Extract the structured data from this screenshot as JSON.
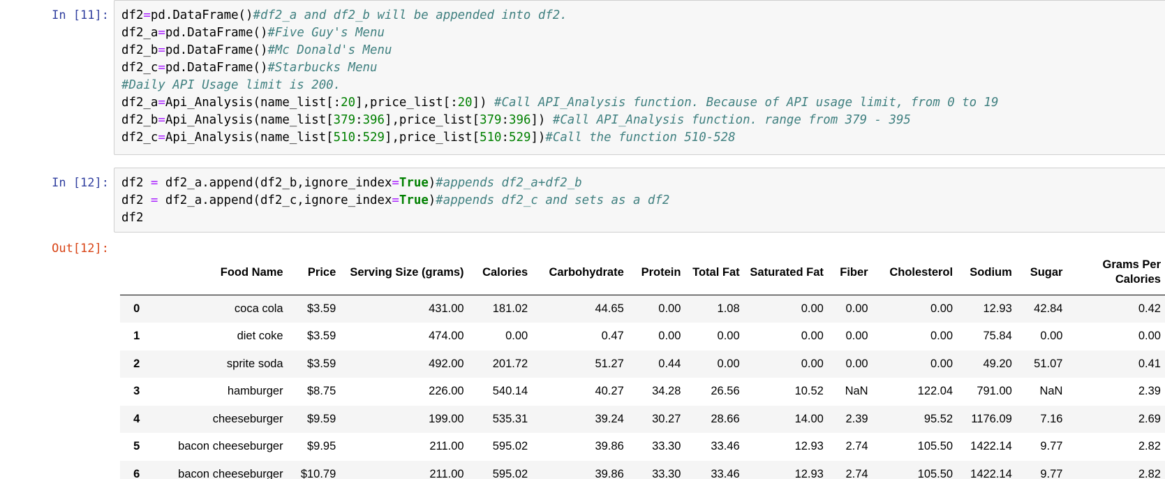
{
  "cells": [
    {
      "prompt": "In [11]:",
      "lines": [
        [
          [
            "df2",
            ""
          ],
          [
            "=",
            "o"
          ],
          [
            "pd.DataFrame()",
            ""
          ],
          [
            "#df2_a and df2_b will be appended into df2.",
            "c"
          ]
        ],
        [
          [
            "df2_a",
            ""
          ],
          [
            "=",
            "o"
          ],
          [
            "pd.DataFrame()",
            ""
          ],
          [
            "#Five Guy's Menu",
            "c"
          ]
        ],
        [
          [
            "df2_b",
            ""
          ],
          [
            "=",
            "o"
          ],
          [
            "pd.DataFrame()",
            ""
          ],
          [
            "#Mc Donald's Menu",
            "c"
          ]
        ],
        [
          [
            "df2_c",
            ""
          ],
          [
            "=",
            "o"
          ],
          [
            "pd.DataFrame()",
            ""
          ],
          [
            "#Starbucks Menu",
            "c"
          ]
        ],
        [
          [
            "#Daily API Usage limit is 200.",
            "c"
          ]
        ],
        [
          [
            "df2_a",
            ""
          ],
          [
            "=",
            "o"
          ],
          [
            "Api_Analysis(name_list[:",
            ""
          ],
          [
            "20",
            "n"
          ],
          [
            "],price_list[:",
            ""
          ],
          [
            "20",
            "n"
          ],
          [
            "]) ",
            ""
          ],
          [
            "#Call API_Analysis function. Because of API usage limit, from 0 to 19",
            "c"
          ]
        ],
        [
          [
            "df2_b",
            ""
          ],
          [
            "=",
            "o"
          ],
          [
            "Api_Analysis(name_list[",
            ""
          ],
          [
            "379",
            "n"
          ],
          [
            ":",
            ""
          ],
          [
            "396",
            "n"
          ],
          [
            "],price_list[",
            ""
          ],
          [
            "379",
            "n"
          ],
          [
            ":",
            ""
          ],
          [
            "396",
            "n"
          ],
          [
            "]) ",
            ""
          ],
          [
            "#Call API_Analysis function. range from 379 - 395",
            "c"
          ]
        ],
        [
          [
            "df2_c",
            ""
          ],
          [
            "=",
            "o"
          ],
          [
            "Api_Analysis(name_list[",
            ""
          ],
          [
            "510",
            "n"
          ],
          [
            ":",
            ""
          ],
          [
            "529",
            "n"
          ],
          [
            "],price_list[",
            ""
          ],
          [
            "510",
            "n"
          ],
          [
            ":",
            ""
          ],
          [
            "529",
            "n"
          ],
          [
            "])",
            ""
          ],
          [
            "#Call the function 510-528",
            "c"
          ]
        ]
      ]
    },
    {
      "prompt": "In [12]:",
      "lines": [
        [
          [
            "df2 ",
            ""
          ],
          [
            "=",
            "o"
          ],
          [
            " df2_a.append(df2_b,ignore_index",
            ""
          ],
          [
            "=",
            "o"
          ],
          [
            "True",
            "k"
          ],
          [
            ")",
            ""
          ],
          [
            "#appends df2_a+df2_b",
            "c"
          ]
        ],
        [
          [
            "df2 ",
            ""
          ],
          [
            "=",
            "o"
          ],
          [
            " df2_a.append(df2_c,ignore_index",
            ""
          ],
          [
            "=",
            "o"
          ],
          [
            "True",
            "k"
          ],
          [
            ")",
            ""
          ],
          [
            "#appends df2_c and sets as a df2",
            "c"
          ]
        ],
        [
          [
            "df2",
            ""
          ]
        ]
      ]
    }
  ],
  "output": {
    "prompt": "Out[12]:",
    "columns": [
      "",
      "Food Name",
      "Price",
      "Serving Size (grams)",
      "Calories",
      "Carbohydrate",
      "Protein",
      "Total Fat",
      "Saturated Fat",
      "Fiber",
      "Cholesterol",
      "Sodium",
      "Sugar",
      "Grams Per Calories"
    ],
    "rows": [
      [
        "0",
        "coca cola",
        "$3.59",
        "431.00",
        "181.02",
        "44.65",
        "0.00",
        "1.08",
        "0.00",
        "0.00",
        "0.00",
        "12.93",
        "42.84",
        "0.42"
      ],
      [
        "1",
        "diet coke",
        "$3.59",
        "474.00",
        "0.00",
        "0.47",
        "0.00",
        "0.00",
        "0.00",
        "0.00",
        "0.00",
        "75.84",
        "0.00",
        "0.00"
      ],
      [
        "2",
        "sprite soda",
        "$3.59",
        "492.00",
        "201.72",
        "51.27",
        "0.44",
        "0.00",
        "0.00",
        "0.00",
        "0.00",
        "49.20",
        "51.07",
        "0.41"
      ],
      [
        "3",
        "hamburger",
        "$8.75",
        "226.00",
        "540.14",
        "40.27",
        "34.28",
        "26.56",
        "10.52",
        "NaN",
        "122.04",
        "791.00",
        "NaN",
        "2.39"
      ],
      [
        "4",
        "cheeseburger",
        "$9.59",
        "199.00",
        "535.31",
        "39.24",
        "30.27",
        "28.66",
        "14.00",
        "2.39",
        "95.52",
        "1176.09",
        "7.16",
        "2.69"
      ],
      [
        "5",
        "bacon cheeseburger",
        "$9.95",
        "211.00",
        "595.02",
        "39.86",
        "33.30",
        "33.46",
        "12.93",
        "2.74",
        "105.50",
        "1422.14",
        "9.77",
        "2.82"
      ],
      [
        "6",
        "bacon cheeseburger",
        "$10.79",
        "211.00",
        "595.02",
        "39.86",
        "33.30",
        "33.46",
        "12.93",
        "2.74",
        "105.50",
        "1422.14",
        "9.77",
        "2.82"
      ]
    ]
  }
}
